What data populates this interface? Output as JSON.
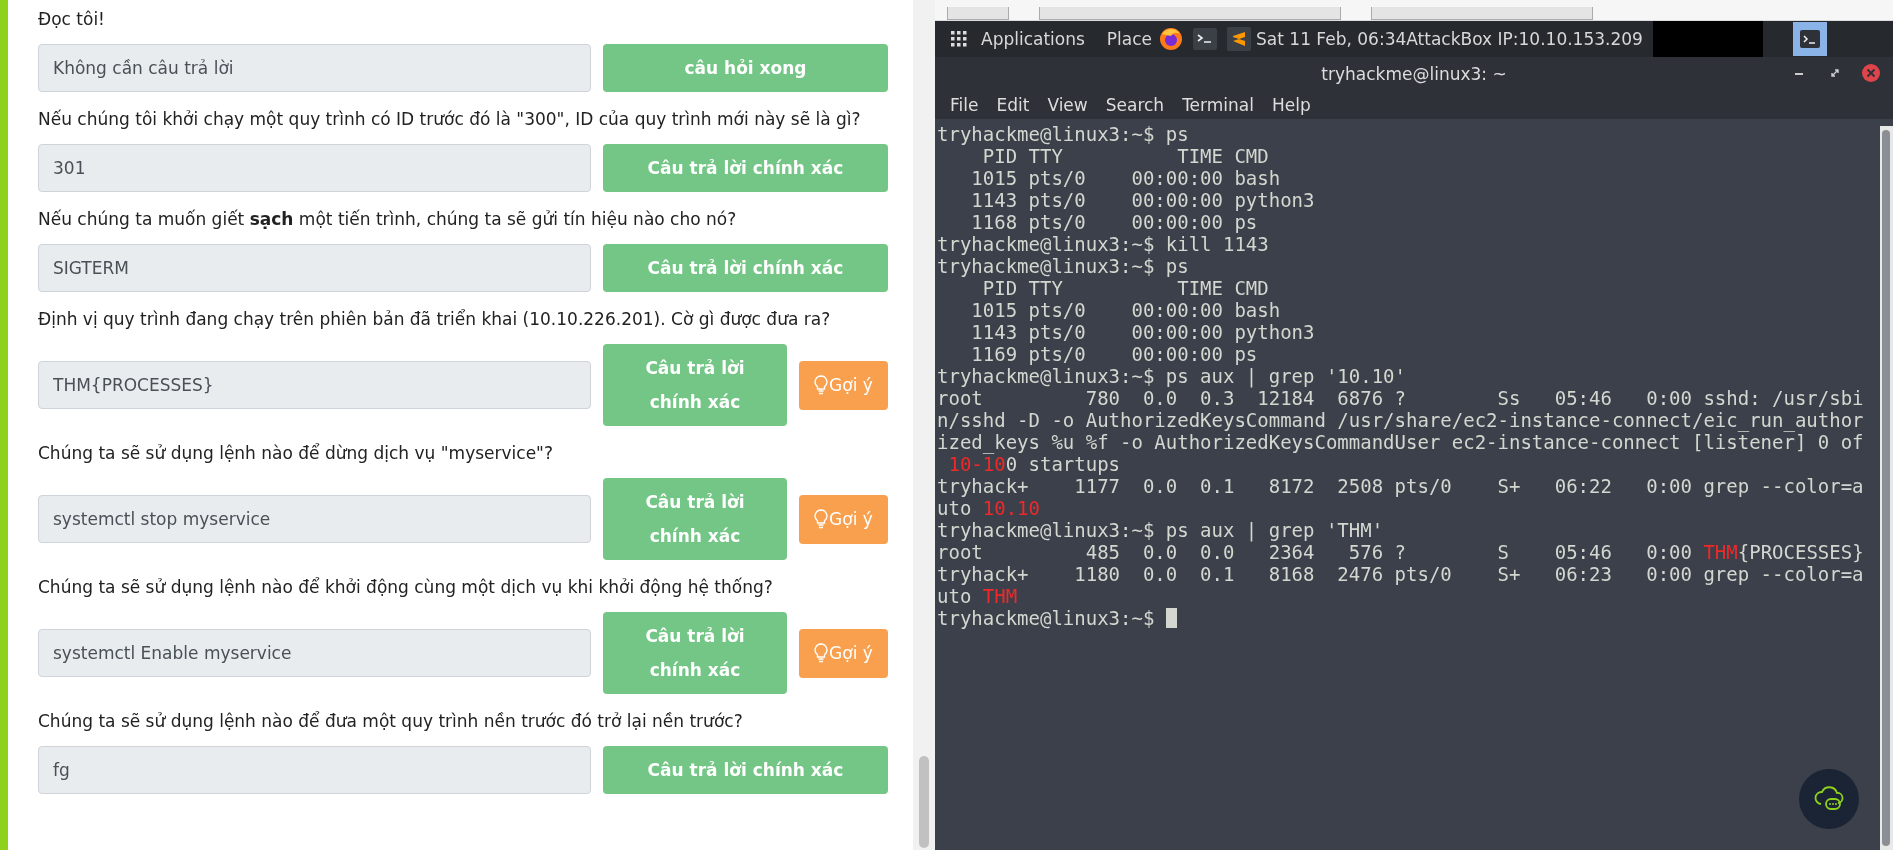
{
  "questions": [
    {
      "question": "Đọc tôi!",
      "answer": "Không cần câu trả lời",
      "button": "câu hỏi xong"
    },
    {
      "question": "Nếu chúng tôi khởi chạy một quy trình có ID trước đó là \"300\", ID của quy trình mới này sẽ là gì?",
      "answer": "301",
      "button": "Câu trả lời chính xác"
    },
    {
      "question": "Nếu chúng ta muốn giết **sạch** một tiến trình, chúng ta sẽ gửi tín hiệu nào cho nó?",
      "answer": "SIGTERM",
      "button": "Câu trả lời chính xác"
    },
    {
      "question": "Định vị quy trình đang chạy trên phiên bản đã triển khai (10.10.226.201). Cờ gì được đưa ra?",
      "answer": "THM{PROCESSES}",
      "button": "Câu trả lời chính xác",
      "hint": "Gợi ý"
    },
    {
      "question": "Chúng ta sẽ sử dụng lệnh nào để dừng dịch vụ \"myservice\"?",
      "answer": "systemctl stop myservice",
      "button": "Câu trả lời chính xác",
      "hint": "Gợi ý"
    },
    {
      "question": "Chúng ta sẽ sử dụng lệnh nào để khởi động cùng một dịch vụ khi khởi động hệ thống?",
      "answer": "systemctl Enable myservice",
      "button": "Câu trả lời chính xác",
      "hint": "Gợi ý"
    },
    {
      "question": "Chúng ta sẽ sử dụng lệnh nào để đưa một quy trình nền trước đó trở lại nền trước?",
      "answer": "fg",
      "button": "Câu trả lời chính xác"
    }
  ],
  "desktop_bar": {
    "applications": "Applications",
    "places": "Place",
    "clock": "Sat 11 Feb, 06:34AttackBox IP:10.10.153.209"
  },
  "terminal": {
    "title": "tryhackme@linux3: ~",
    "menu": [
      "File",
      "Edit",
      "View",
      "Search",
      "Terminal",
      "Help"
    ],
    "lines": [
      [
        {
          "text": "tryhackme@linux3:~$ ps",
          "match": false
        }
      ],
      [
        {
          "text": "    PID TTY          TIME CMD",
          "match": false
        }
      ],
      [
        {
          "text": "   1015 pts/0    00:00:00 bash",
          "match": false
        }
      ],
      [
        {
          "text": "   1143 pts/0    00:00:00 python3",
          "match": false
        }
      ],
      [
        {
          "text": "   1168 pts/0    00:00:00 ps",
          "match": false
        }
      ],
      [
        {
          "text": "tryhackme@linux3:~$ kill 1143",
          "match": false
        }
      ],
      [
        {
          "text": "tryhackme@linux3:~$ ps",
          "match": false
        }
      ],
      [
        {
          "text": "    PID TTY          TIME CMD",
          "match": false
        }
      ],
      [
        {
          "text": "   1015 pts/0    00:00:00 bash",
          "match": false
        }
      ],
      [
        {
          "text": "   1143 pts/0    00:00:00 python3",
          "match": false
        }
      ],
      [
        {
          "text": "   1169 pts/0    00:00:00 ps",
          "match": false
        }
      ],
      [
        {
          "text": "tryhackme@linux3:~$ ps aux | grep '10.10'",
          "match": false
        }
      ],
      [
        {
          "text": "root         780  0.0  0.3  12184  6876 ?        Ss   05:46   0:00 sshd: /usr/sbi",
          "match": false
        }
      ],
      [
        {
          "text": "n/sshd -D -o AuthorizedKeysCommand /usr/share/ec2-instance-connect/eic_run_author",
          "match": false
        }
      ],
      [
        {
          "text": "ized_keys %u %f -o AuthorizedKeysCommandUser ec2-instance-connect [listener] 0 of",
          "match": false
        }
      ],
      [
        {
          "text": " 10-10",
          "match": true
        },
        {
          "text": "0 startups",
          "match": false
        }
      ],
      [
        {
          "text": "tryhack+    1177  0.0  0.1   8172  2508 pts/0    S+   06:22   0:00 grep --color=a",
          "match": false
        }
      ],
      [
        {
          "text": "uto ",
          "match": false
        },
        {
          "text": "10.10",
          "match": true
        }
      ],
      [
        {
          "text": "tryhackme@linux3:~$ ps aux | grep 'THM'",
          "match": false
        }
      ],
      [
        {
          "text": "root         485  0.0  0.0   2364   576 ?        S    05:46   0:00 ",
          "match": false
        },
        {
          "text": "THM",
          "match": true
        },
        {
          "text": "{PROCESSES}",
          "match": false
        }
      ],
      [
        {
          "text": "tryhack+    1180  0.0  0.1   8168  2476 pts/0    S+   06:23   0:00 grep --color=a",
          "match": false
        }
      ],
      [
        {
          "text": "uto ",
          "match": false
        },
        {
          "text": "THM",
          "match": true
        }
      ],
      [
        {
          "text": "tryhackme@linux3:~$ ",
          "match": false
        }
      ]
    ]
  }
}
